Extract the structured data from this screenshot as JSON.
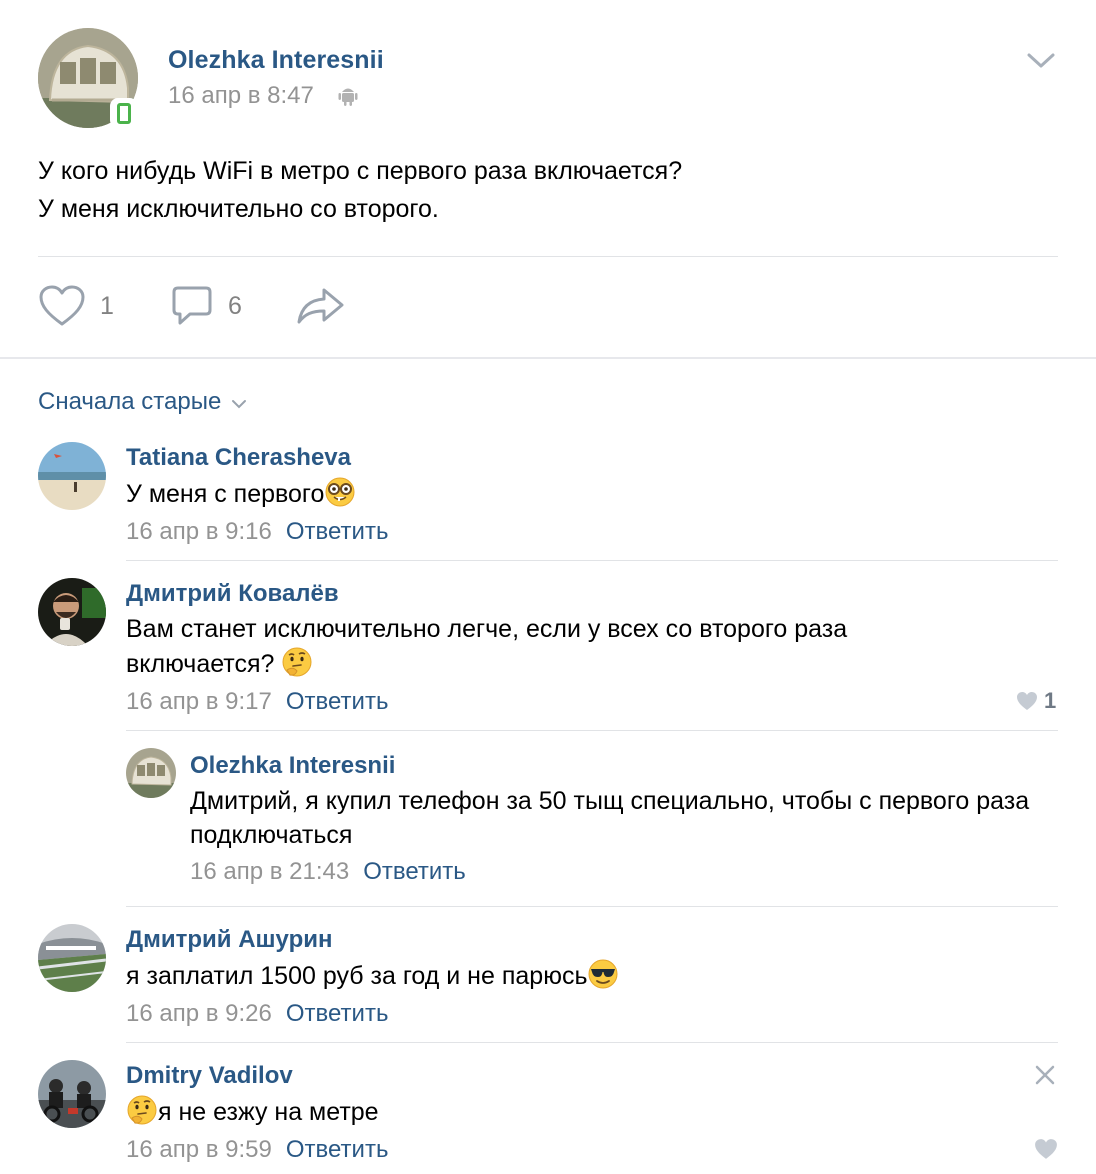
{
  "post": {
    "author": "Olezhka Interesnii",
    "date": "16 апр в 8:47",
    "text_line1": "У кого нибудь WiFi в метро с первого раза включается?",
    "text_line2": "У меня исключительно со второго.",
    "likes": "1",
    "comments": "6"
  },
  "comments_section": {
    "sort_label": "Сначала старые"
  },
  "comments": [
    {
      "author": "Tatiana Cherasheva",
      "text": "У меня с первого",
      "emoji": "nerd-face",
      "date": "16 апр в 9:16",
      "reply_label": "Ответить"
    },
    {
      "author": "Дмитрий Ковалёв",
      "text": "Вам станет исключительно легче, если у всех со второго раза включается?",
      "emoji": "thinking-face",
      "date": "16 апр в 9:17",
      "reply_label": "Ответить",
      "likes": "1"
    },
    {
      "author": "Olezhka Interesnii",
      "text": "Дмитрий, я купил телефон за 50 тыщ специально, чтобы с первого раза подключаться",
      "date": "16 апр в 21:43",
      "reply_label": "Ответить"
    },
    {
      "author": "Дмитрий Ашурин",
      "text": "я заплатил 1500 руб за год и не парюсь",
      "emoji": "sunglasses-face",
      "date": "16 апр в 9:26",
      "reply_label": "Ответить"
    },
    {
      "author": "Dmitry Vadilov",
      "text": "я не езжу на метре",
      "emoji": "thinking-face",
      "date": "16 апр в 9:59",
      "reply_label": "Ответить"
    }
  ],
  "colors": {
    "link": "#2a5885",
    "meta": "#939393",
    "online": "#4bb34b",
    "divider": "#e1e3e6"
  }
}
